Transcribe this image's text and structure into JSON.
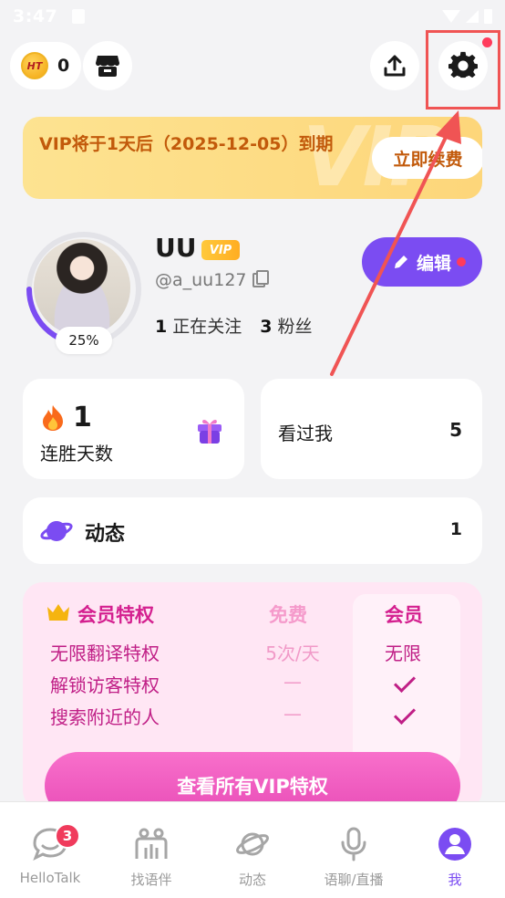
{
  "status_bar": {
    "time": "3:47"
  },
  "header": {
    "coin_label": "HT",
    "coin_count": "0"
  },
  "vip_banner": {
    "text": "VIP将于1天后（2025-12-05）到期",
    "button": "立即续费",
    "watermark": "VIP"
  },
  "profile": {
    "name": "UU",
    "vip_tag": "VIP",
    "handle": "@a_uu127",
    "completion": "25%",
    "following_count": "1",
    "following_label": "正在关注",
    "followers_count": "3",
    "followers_label": "粉丝",
    "edit_label": "编辑"
  },
  "streak": {
    "count": "1",
    "label": "连胜天数"
  },
  "visitors": {
    "label": "看过我",
    "count": "5"
  },
  "moments": {
    "label": "动态",
    "count": "1"
  },
  "vip_privileges": {
    "title": "会员特权",
    "free_header": "免费",
    "member_header": "会员",
    "rows": [
      {
        "feature": "无限翻译特权",
        "free": "5次/天",
        "member": "无限"
      },
      {
        "feature": "解锁访客特权",
        "free": "—",
        "member": "✓"
      },
      {
        "feature": "搜索附近的人",
        "free": "—",
        "member": "✓"
      }
    ],
    "cta": "查看所有VIP特权"
  },
  "nav": {
    "items": [
      {
        "label": "HelloTalk",
        "badge": "3"
      },
      {
        "label": "找语伴"
      },
      {
        "label": "动态"
      },
      {
        "label": "语聊/直播"
      },
      {
        "label": "我"
      }
    ]
  },
  "colors": {
    "accent": "#7b4cf2",
    "vip_text": "#c25a0b",
    "vip_pink": "#d4208f",
    "annotation": "#f05454"
  }
}
